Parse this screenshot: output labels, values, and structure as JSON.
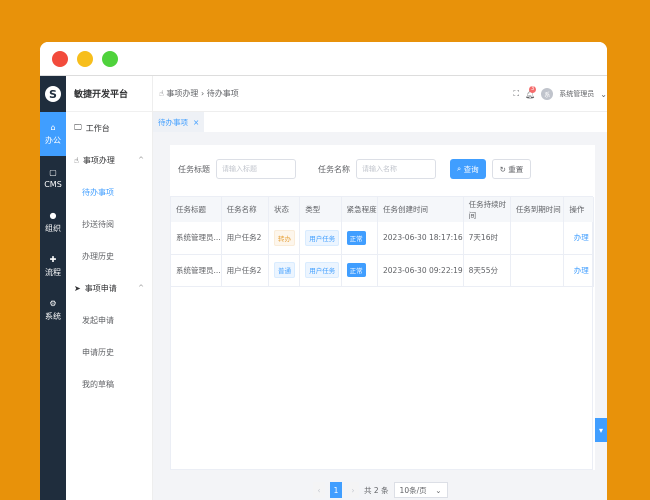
{
  "app": {
    "title": "敏捷开发平台",
    "logo": "S"
  },
  "rail": [
    {
      "label": "办公",
      "icon": "home-icon"
    },
    {
      "label": "CMS",
      "icon": "document-icon"
    },
    {
      "label": "组织",
      "icon": "user-icon"
    },
    {
      "label": "流程",
      "icon": "flow-icon"
    },
    {
      "label": "系统",
      "icon": "gear-icon"
    }
  ],
  "submenu": {
    "workbench": "工作台",
    "group1": "事项办理",
    "todo": "待办事项",
    "cc": "抄送待阅",
    "history": "办理历史",
    "group2": "事项申请",
    "apply": "发起申请",
    "apply_history": "申请历史",
    "drafts": "我的草稿"
  },
  "header": {
    "breadcrumb1": "事项办理",
    "breadcrumb2": "待办事项",
    "notify_count": "3",
    "avatar": "系",
    "user": "系统管理员"
  },
  "tab": {
    "label": "待办事项",
    "close": "×"
  },
  "search": {
    "title_label": "任务标题",
    "title_placeholder": "请输入标题",
    "name_label": "任务名称",
    "name_placeholder": "请输入名称",
    "query": "查询",
    "reset": "重置"
  },
  "table": {
    "headers": [
      "任务标题",
      "任务名称",
      "状态",
      "类型",
      "紧急程度",
      "任务创建时间",
      "任务持续时间",
      "任务到期时间",
      "操作"
    ],
    "rows": [
      {
        "title": "系统管理员...",
        "name": "用户任务2",
        "status": "转办",
        "type": "用户任务",
        "urgency": "正常",
        "created": "2023-06-30 18:17:16",
        "duration": "7天16时",
        "due": "",
        "action": "办理"
      },
      {
        "title": "系统管理员...",
        "name": "用户任务2",
        "status": "普通",
        "type": "用户任务",
        "urgency": "正常",
        "created": "2023-06-30 09:22:19",
        "duration": "8天55分",
        "due": "",
        "action": "办理"
      }
    ]
  },
  "pagination": {
    "prev": "‹",
    "page": "1",
    "next": "›",
    "total": "共 2 条",
    "size": "10条/页"
  }
}
